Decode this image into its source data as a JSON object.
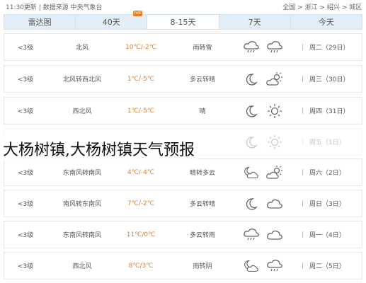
{
  "topbar": {
    "left": "11:30更新 | 数据来源 中央气象台",
    "right": "全国 > 浙江 > 绍兴 > 城区"
  },
  "tabs": [
    {
      "label": "雷达图",
      "active": false
    },
    {
      "label": "40天",
      "active": false,
      "badge": "hot"
    },
    {
      "label": "8-15天",
      "active": true
    },
    {
      "label": "7天",
      "active": false
    },
    {
      "label": "今天",
      "active": false
    }
  ],
  "rows": [
    {
      "date": "周二（29日）",
      "icon1": "cloud-rain-icon",
      "icon2": "cloud-rain-icon",
      "desc": "雨转雪",
      "temp": "10℃/-2℃",
      "hot": true,
      "wind": "北风",
      "level": "<3级",
      "dim": false
    },
    {
      "date": "周三（30日）",
      "icon1": "sun-cloud-icon",
      "icon2": "moon-icon",
      "desc": "多云转晴",
      "temp": "1℃/-5℃",
      "hot": true,
      "wind": "北风转西北风",
      "level": "<3级",
      "dim": false
    },
    {
      "date": "周四（31日）",
      "icon1": "sun-icon",
      "icon2": "moon-icon",
      "desc": "晴",
      "temp": "1℃/-5℃",
      "hot": true,
      "wind": "西北风",
      "level": "<3级",
      "dim": false
    },
    {
      "date": "周五（1日）",
      "icon1": "sun-icon",
      "icon2": "moon-icon",
      "desc": "",
      "temp": "",
      "hot": false,
      "wind": "",
      "level": "",
      "dim": true
    },
    {
      "date": "周六（2日）",
      "icon1": "sun-cloud-icon",
      "icon2": "cloud-moon-icon",
      "desc": "晴转多云",
      "temp": "4℃/-4℃",
      "hot": true,
      "wind": "东南风转南风",
      "level": "<3级",
      "dim": false
    },
    {
      "date": "周日（3日）",
      "icon1": "cloud-icon",
      "icon2": "moon-icon",
      "desc": "多云转晴",
      "temp": "7℃/-2℃",
      "hot": true,
      "wind": "南风转东南风",
      "level": "<3级",
      "dim": false
    },
    {
      "date": "周一（4日）",
      "icon1": "cloud-icon",
      "icon2": "cloud-rain-icon",
      "desc": "多云转雨",
      "temp": "11℃/0℃",
      "hot": true,
      "wind": "东南风转南风",
      "level": "<3级",
      "dim": false
    },
    {
      "date": "周二（5日）",
      "icon1": "cloud-rain-icon",
      "icon2": "cloud-moon-icon",
      "desc": "雨转阴",
      "temp": "8℃/3℃",
      "hot": true,
      "wind": "西北风",
      "level": "<3级",
      "dim": false
    }
  ],
  "overlay_title": "大杨树镇,大杨树镇天气预报"
}
